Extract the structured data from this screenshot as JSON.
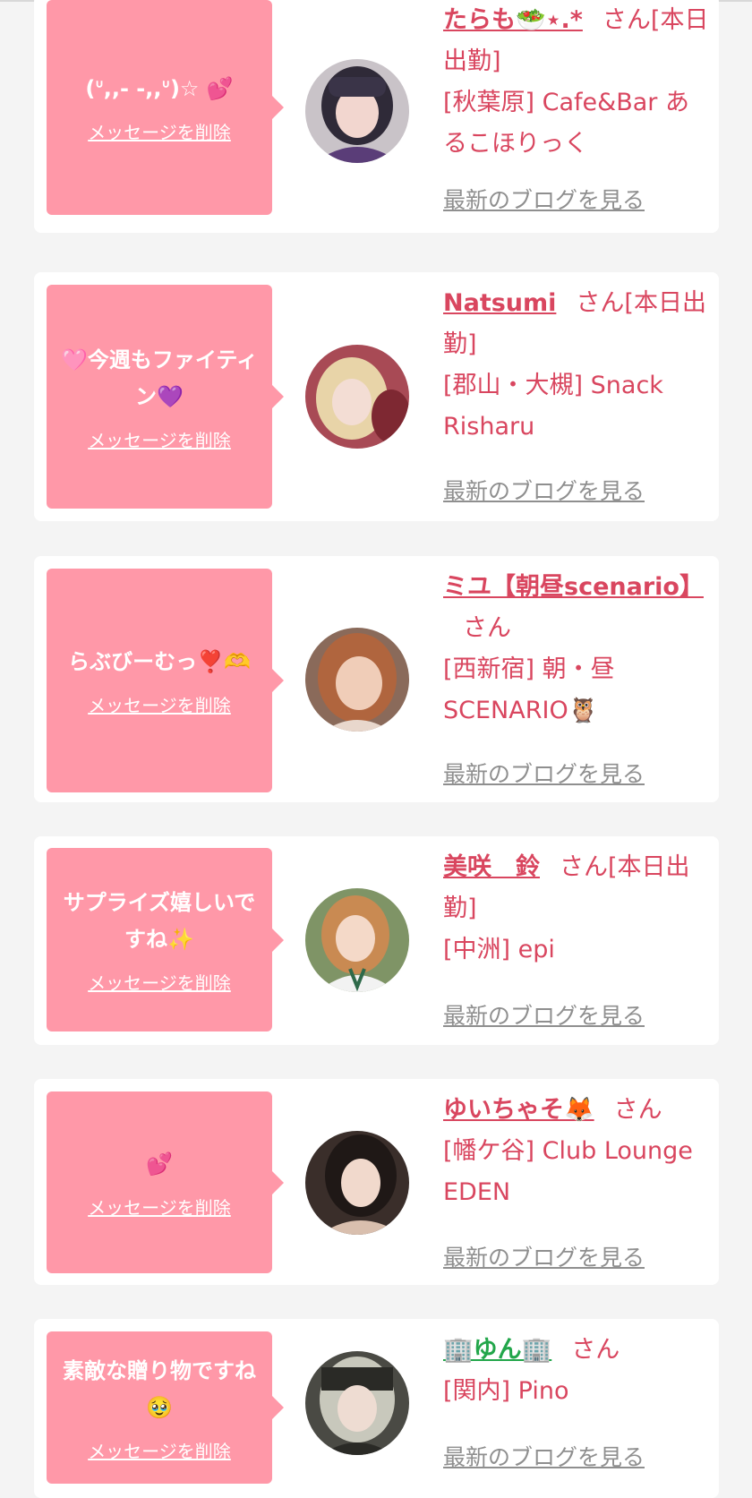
{
  "delete_label": "メッセージを削除",
  "blog_label": "最新のブログを見る",
  "honorific": "さん",
  "colors": {
    "page_bg": "#f4f4f4",
    "card_bg": "#ffffff",
    "bubble_bg": "#ff98a8",
    "name_accent": "#d9465f",
    "muted_link": "#8f8f8f"
  },
  "messages": [
    {
      "text": "(ᐡ,,- -,,ᐡ)☆ 💕",
      "name": "たらも🥗⋆.*",
      "status": "[本日出勤]",
      "shop": "[秋葉原] Cafe&Bar あるこほりっく"
    },
    {
      "text": "🩷今週もファイティン💜",
      "name": "Natsumi",
      "status": "[本日出勤]",
      "shop": "[郡山・大槻] Snack Risharu"
    },
    {
      "text": "らぶびーむっ❣️🫶",
      "name": "ミユ【朝昼scenario】",
      "status": "",
      "shop": "[西新宿] 朝・昼SCENARIO🦉"
    },
    {
      "text": "サプライズ嬉しいですね✨",
      "name": "美咲　鈴",
      "status": "[本日出勤]",
      "shop": "[中洲] epi"
    },
    {
      "text": "💕",
      "name": "ゆいちゃそ🦊",
      "status": "",
      "shop": "[幡ケ谷] Club Lounge EDEN"
    },
    {
      "text": "素敵な贈り物ですね🥹",
      "name": "🏢ゆん🏢",
      "status": "",
      "shop": "[関内] Pino"
    }
  ]
}
